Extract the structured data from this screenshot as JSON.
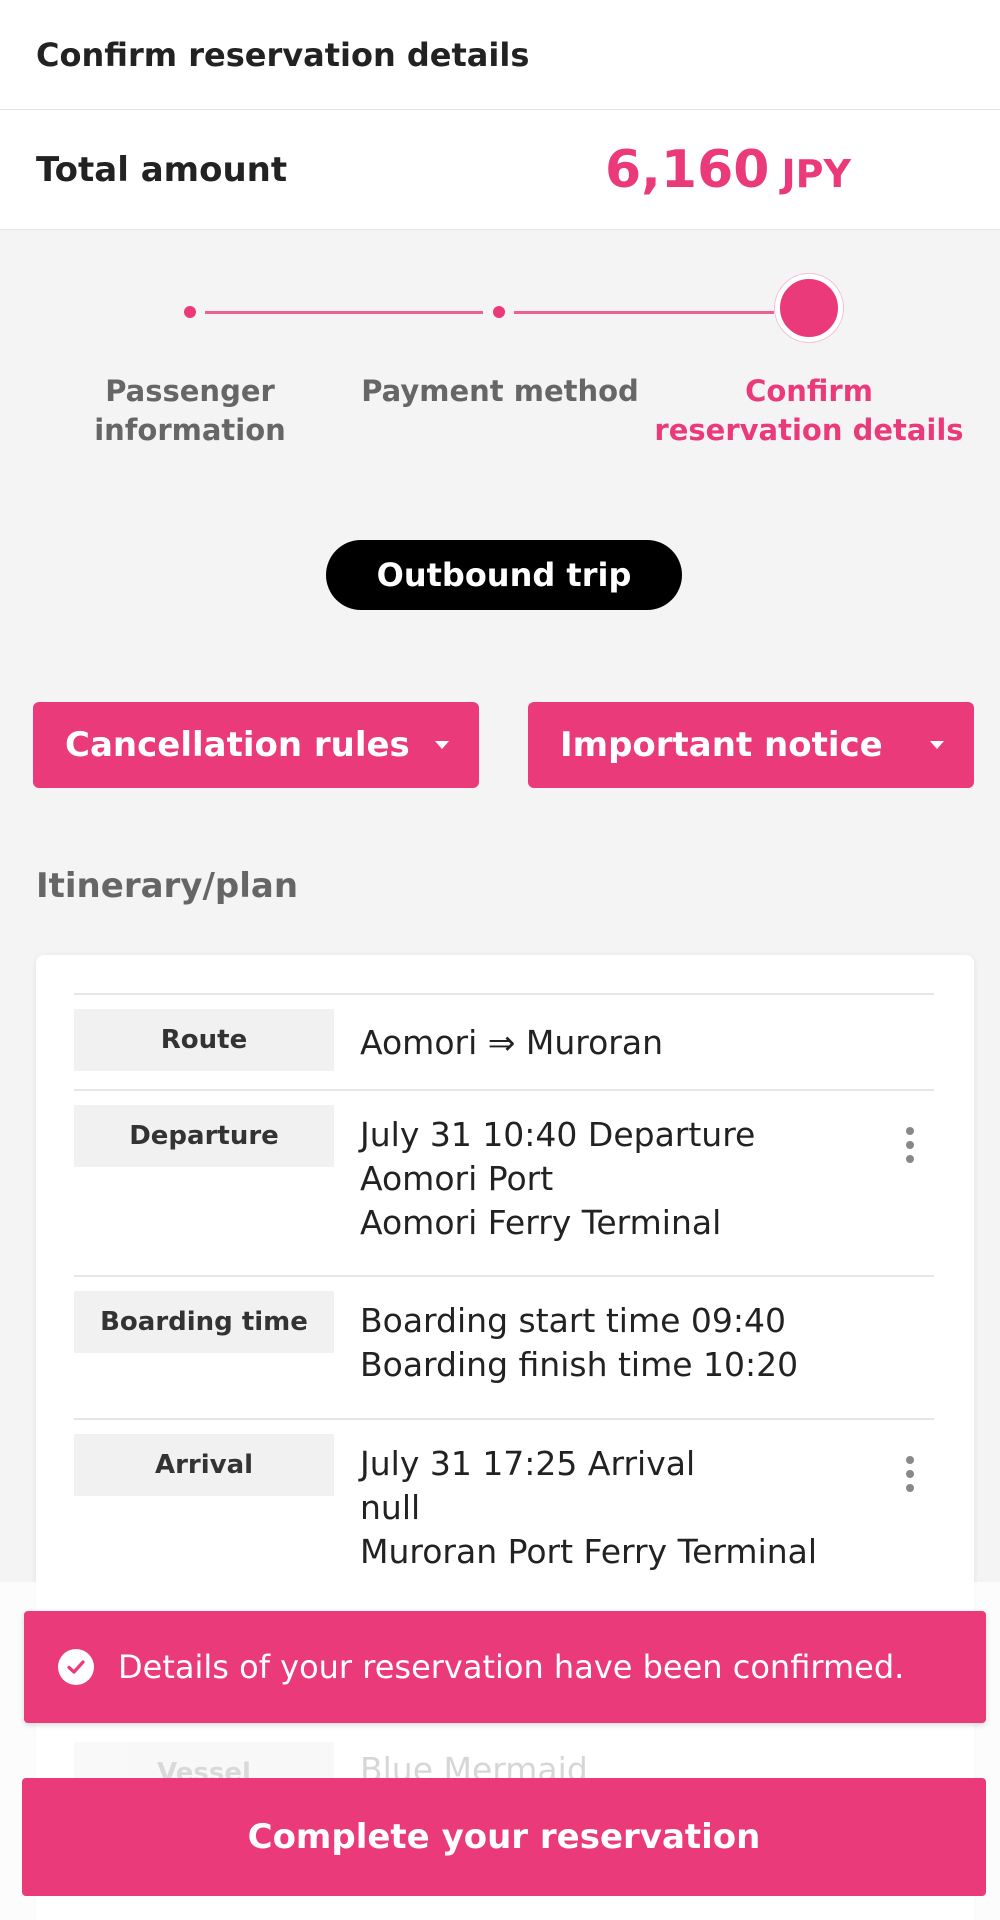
{
  "header": {
    "title": "Confirm reservation details"
  },
  "total": {
    "label": "Total amount",
    "amount": "6,160",
    "currency": "JPY"
  },
  "stepper": {
    "steps": [
      {
        "label_line1": "Passenger",
        "label_line2": "information",
        "state": "done"
      },
      {
        "label_line1": "Payment method",
        "label_line2": "",
        "state": "done"
      },
      {
        "label_line1": "Confirm",
        "label_line2": "reservation details",
        "state": "current"
      }
    ]
  },
  "trip": {
    "label": "Outbound trip"
  },
  "accordions": {
    "cancellation": "Cancellation rules",
    "notice": "Important notice"
  },
  "itinerary": {
    "title": "Itinerary/plan",
    "rows": [
      {
        "key": "Route",
        "lines": [
          "Aomori ⇒ Muroran"
        ]
      },
      {
        "key": "Departure",
        "lines": [
          "July 31 10:40 Departure",
          "Aomori Port",
          "Aomori Ferry Terminal"
        ]
      },
      {
        "key": "Boarding time",
        "lines": [
          "Boarding start time 09:40",
          "Boarding finish time 10:20"
        ]
      },
      {
        "key": "Arrival",
        "lines": [
          "July 31 17:25 Arrival",
          "null",
          "Muroran Port Ferry Terminal"
        ]
      },
      {
        "key": "Vessel",
        "lines": [
          "Blue Mermaid"
        ]
      }
    ]
  },
  "toast": {
    "message": "Details of your reservation have been confirmed."
  },
  "cta": {
    "label": "Complete your reservation"
  },
  "colors": {
    "accent": "#ea3a7a",
    "background": "#f4f4f4",
    "pill": "#000000"
  }
}
